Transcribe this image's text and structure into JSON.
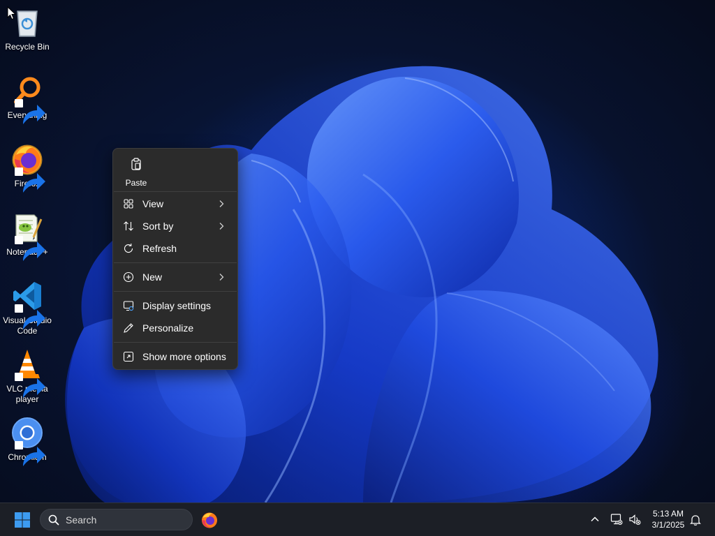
{
  "desktop_icons": [
    {
      "label": "Recycle Bin",
      "icon": "recycle-bin-icon",
      "shortcut": false
    },
    {
      "label": "Everything",
      "icon": "everything-search-icon",
      "shortcut": true
    },
    {
      "label": "Firefox",
      "icon": "firefox-icon",
      "shortcut": true
    },
    {
      "label": "Notepad++",
      "icon": "notepad-plus-plus-icon",
      "shortcut": true
    },
    {
      "label": "Visual Studio Code",
      "icon": "vscode-icon",
      "shortcut": true
    },
    {
      "label": "VLC media player",
      "icon": "vlc-icon",
      "shortcut": true
    },
    {
      "label": "Chromium",
      "icon": "chromium-icon",
      "shortcut": true
    }
  ],
  "context_menu": {
    "paste_label": "Paste",
    "items": [
      {
        "label": "View",
        "icon": "grid-view-icon",
        "submenu": true
      },
      {
        "label": "Sort by",
        "icon": "sort-icon",
        "submenu": true
      },
      {
        "label": "Refresh",
        "icon": "refresh-icon",
        "submenu": false
      },
      {
        "label": "New",
        "icon": "plus-circle-icon",
        "submenu": true
      },
      {
        "label": "Display settings",
        "icon": "display-settings-icon",
        "submenu": false
      },
      {
        "label": "Personalize",
        "icon": "pen-icon",
        "submenu": false
      },
      {
        "label": "Show more options",
        "icon": "more-options-icon",
        "submenu": false
      }
    ]
  },
  "taskbar": {
    "search_placeholder": "Search",
    "pinned_apps": [
      "firefox-icon"
    ],
    "clock_time": "5:13 AM",
    "clock_date": "3/1/2025"
  },
  "colors": {
    "menu_background": "#2b2b2b",
    "taskbar_background": "#1c1f26",
    "accent_blue": "#1f6feb",
    "start_button": "#3d9bf0"
  }
}
